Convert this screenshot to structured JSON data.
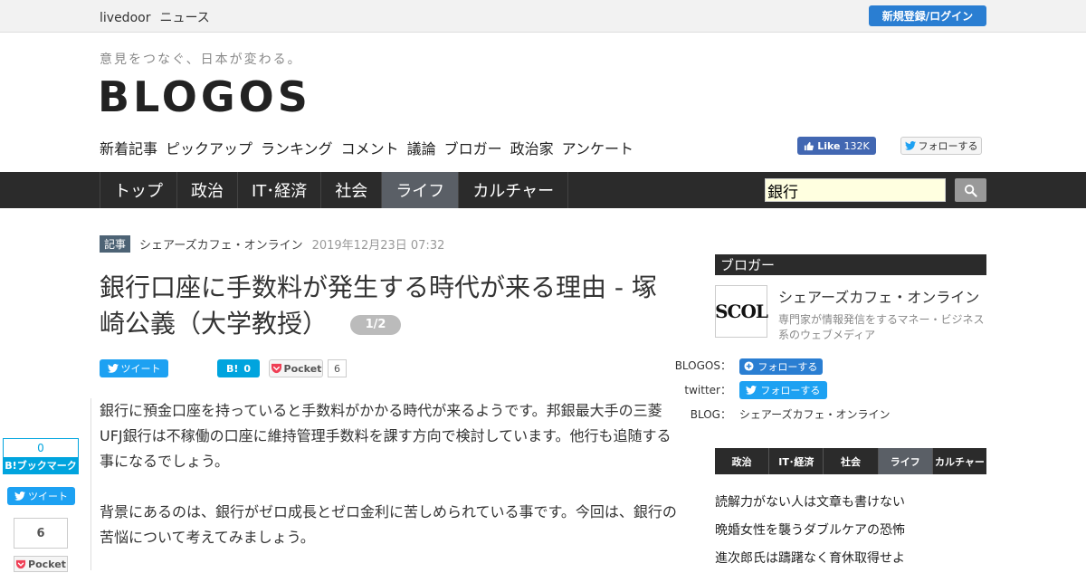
{
  "topbar": {
    "brand_a": "livedoor",
    "brand_b": "ニュース",
    "login_label": "新規登録/ログイン"
  },
  "header": {
    "tagline": "意見をつなぐ、日本が変わる。",
    "logo": "BLOGOS",
    "subnav": [
      "新着記事",
      "ピックアップ",
      "ランキング",
      "コメント",
      "議論",
      "ブロガー",
      "政治家",
      "アンケート"
    ],
    "fb_like_label": "Like",
    "fb_like_count": "132K",
    "tw_follow_label": "フォローする"
  },
  "mainnav": {
    "items": [
      {
        "label": "トップ",
        "active": false
      },
      {
        "label": "政治",
        "active": false
      },
      {
        "label": "IT･経済",
        "active": false
      },
      {
        "label": "社会",
        "active": false
      },
      {
        "label": "ライフ",
        "active": true
      },
      {
        "label": "カルチャー",
        "active": false
      }
    ],
    "search_value": "銀行"
  },
  "article": {
    "badge": "記事",
    "source": "シェアーズカフェ・オンライン",
    "date": "2019年12月23日 07:32",
    "title": "銀行口座に手数料が発生する時代が来る理由 - 塚崎公義（大学教授）",
    "page_indicator": "1/2",
    "tweet_label": "ツイート",
    "hatena_label": "B!",
    "hatena_count": "0",
    "pocket_label": "Pocket",
    "pocket_count": "6",
    "paragraphs": [
      "銀行に預金口座を持っていると手数料がかかる時代が来るようです。邦銀最大手の三菱UFJ銀行は不稼働の口座に維持管理手数料を課す方向で検討しています。他行も追随する事になるでしょう。",
      "背景にあるのは、銀行がゼロ成長とゼロ金利に苦しめられている事です。今回は、銀行の苦悩について考えてみましょう。"
    ]
  },
  "floating_share": {
    "bookmark_count": "0",
    "bookmark_label": "B!ブックマーク",
    "tweet_label": "ツイート",
    "pocket_count": "6",
    "pocket_label": "Pocket"
  },
  "sidebar": {
    "heading": "ブロガー",
    "avatar_text": "SCOL",
    "blogger_name": "シェアーズカフェ・オンライン",
    "blogger_desc": "専門家が情報発信をするマネー・ビジネス系のウェブメディア",
    "blogos_label": "BLOGOS：",
    "blogos_follow": "フォローする",
    "twitter_label": "twitter：",
    "twitter_follow": "フォローする",
    "blog_label": "BLOG：",
    "blog_value": "シェアーズカフェ・オンライン",
    "tabs": [
      {
        "label": "政治",
        "active": false
      },
      {
        "label": "IT･経済",
        "active": false
      },
      {
        "label": "社会",
        "active": false
      },
      {
        "label": "ライフ",
        "active": true
      },
      {
        "label": "カルチャー",
        "active": false
      }
    ],
    "list": [
      "読解力がない人は文章も書けない",
      "晩婚女性を襲うダブルケアの恐怖",
      "進次郎氏は躊躇なく育休取得せよ"
    ]
  }
}
